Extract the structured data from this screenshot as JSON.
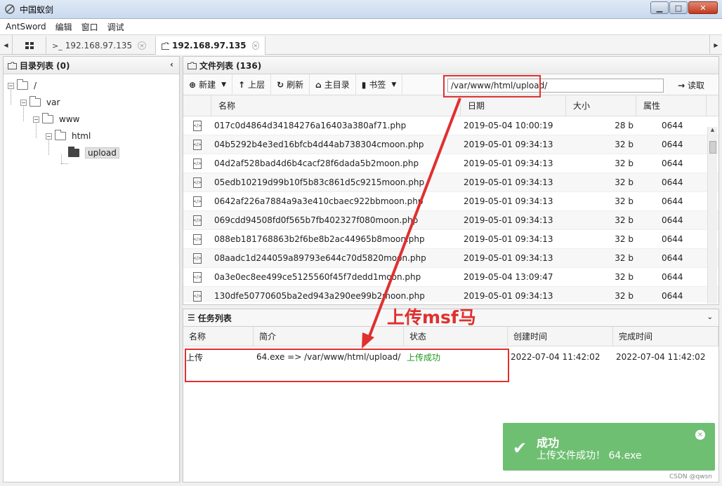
{
  "window": {
    "title": "中国蚁剑"
  },
  "menu": [
    "AntSword",
    "编辑",
    "窗口",
    "调试"
  ],
  "tabs": [
    {
      "label": "192.168.97.135",
      "prefix": ">_"
    },
    {
      "label": "192.168.97.135"
    }
  ],
  "left_panel": {
    "title": "目录列表 (0)",
    "tree": [
      {
        "label": "/",
        "depth": 0
      },
      {
        "label": "var",
        "depth": 1
      },
      {
        "label": "www",
        "depth": 2
      },
      {
        "label": "html",
        "depth": 3
      },
      {
        "label": "upload",
        "depth": 4,
        "selected": true
      }
    ]
  },
  "file_panel": {
    "title": "文件列表 (136)",
    "toolbar": {
      "new": "新建",
      "up": "上层",
      "refresh": "刷新",
      "home": "主目录",
      "bookmark": "书签",
      "path": "/var/www/html/upload/",
      "read": "读取"
    },
    "columns": [
      "名称",
      "日期",
      "大小",
      "属性"
    ],
    "rows": [
      {
        "name": "017c0d4864d34184276a16403a380af71.php",
        "date": "2019-05-04 10:00:19",
        "size": "28 b",
        "perm": "0644"
      },
      {
        "name": "04b5292b4e3ed16bfcb4d44ab738304cmoon.php",
        "date": "2019-05-01 09:34:13",
        "size": "32 b",
        "perm": "0644"
      },
      {
        "name": "04d2af528bad4d6b4cacf28f6dada5b2moon.php",
        "date": "2019-05-01 09:34:13",
        "size": "32 b",
        "perm": "0644"
      },
      {
        "name": "05edb10219d99b10f5b83c861d5c9215moon.php",
        "date": "2019-05-01 09:34:13",
        "size": "32 b",
        "perm": "0644"
      },
      {
        "name": "0642af226a7884a9a3e410cbaec922bbmoon.php",
        "date": "2019-05-01 09:34:13",
        "size": "32 b",
        "perm": "0644"
      },
      {
        "name": "069cdd94508fd0f565b7fb402327f080moon.php",
        "date": "2019-05-01 09:34:13",
        "size": "32 b",
        "perm": "0644"
      },
      {
        "name": "088eb181768863b2f6be8b2ac44965b8moon.php",
        "date": "2019-05-01 09:34:13",
        "size": "32 b",
        "perm": "0644"
      },
      {
        "name": "08aadc1d244059a89793e644c70d5820moon.php",
        "date": "2019-05-01 09:34:13",
        "size": "32 b",
        "perm": "0644"
      },
      {
        "name": "0a3e0ec8ee499ce5125560f45f7dedd1moon.php",
        "date": "2019-05-04 13:09:47",
        "size": "32 b",
        "perm": "0644"
      },
      {
        "name": "130dfe50770605ba2ed943a290ee99b2moon.php",
        "date": "2019-05-01 09:34:13",
        "size": "32 b",
        "perm": "0644"
      }
    ]
  },
  "task_panel": {
    "title": "任务列表",
    "columns": [
      "名称",
      "简介",
      "状态",
      "创建时间",
      "完成时间"
    ],
    "rows": [
      {
        "name": "上传",
        "desc": "64.exe => /var/www/html/upload/",
        "status": "上传成功",
        "created": "2022-07-04 11:42:02",
        "finished": "2022-07-04 11:42:02"
      }
    ]
  },
  "annotation": {
    "text": "上传msf马"
  },
  "toast": {
    "title": "成功",
    "message": "上传文件成功！ 64.exe"
  },
  "watermark": "CSDN @qwsn",
  "colors": {
    "annotation": "#e03030",
    "toast_bg": "#6fbf73",
    "success_text": "#1a9a1a"
  }
}
